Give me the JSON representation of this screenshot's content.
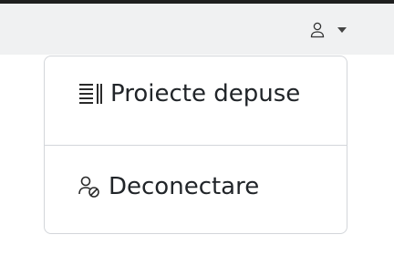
{
  "topbar": {
    "user_icon": "user-icon",
    "caret_icon": "caret-down-icon",
    "background": "#f0f1f2"
  },
  "dropdown": {
    "items": [
      {
        "label": "Proiecte depuse",
        "icon": "list-text-icon"
      },
      {
        "label": "Deconectare",
        "icon": "user-blocked-icon"
      }
    ]
  },
  "colors": {
    "text": "#212529",
    "border": "#d3d6da"
  }
}
